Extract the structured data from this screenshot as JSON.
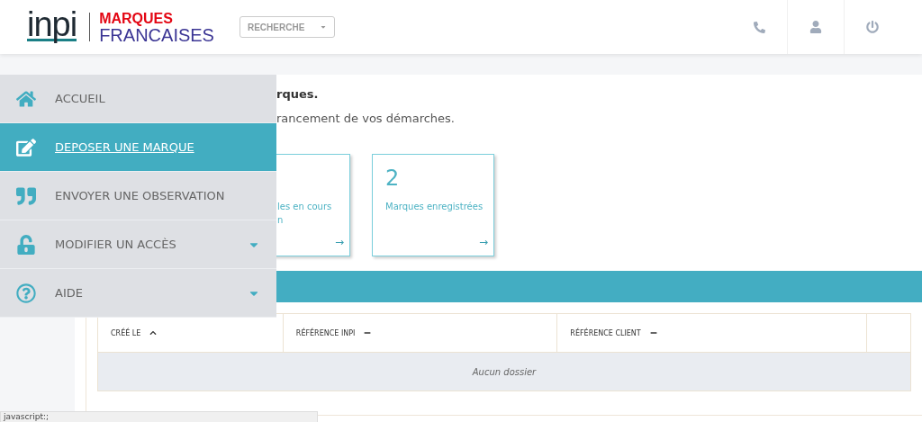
{
  "header": {
    "logo": "inpi",
    "brand_top": "MARQUES",
    "brand_bottom": "FRANCAISES",
    "search_select": "RECHERCHE"
  },
  "intro": {
    "title": "rques.",
    "subtitle": "rancement de vos démarches."
  },
  "cards": [
    {
      "label_lines": [
        "les en cours",
        "n"
      ],
      "arrow": "→"
    },
    {
      "count": "2",
      "label_lines": [
        "Marques enregistrées"
      ],
      "arrow": "→"
    }
  ],
  "table": {
    "columns": [
      {
        "kind": "sort-asc",
        "label": "CRÉÉ LE"
      },
      {
        "kind": "sort-none",
        "label": "RÉFÉRENCE INPI"
      },
      {
        "kind": "sort-none",
        "label": "RÉFÉRENCE CLIENT"
      },
      {
        "kind": "blank"
      }
    ],
    "empty": "Aucun dossier"
  },
  "menu": [
    {
      "kind": "home",
      "label": "ACCUEIL",
      "selected": false,
      "submenu": false
    },
    {
      "kind": "edit",
      "label": "DEPOSER UNE MARQUE",
      "selected": true,
      "submenu": false
    },
    {
      "kind": "quote",
      "label": "ENVOYER UNE OBSERVATION",
      "selected": false,
      "submenu": false
    },
    {
      "kind": "unlock",
      "label": "MODIFIER UN ACCÈS",
      "selected": false,
      "submenu": true
    },
    {
      "kind": "help",
      "label": "AIDE",
      "selected": false,
      "submenu": true
    }
  ],
  "status_bar": "javascript:;"
}
